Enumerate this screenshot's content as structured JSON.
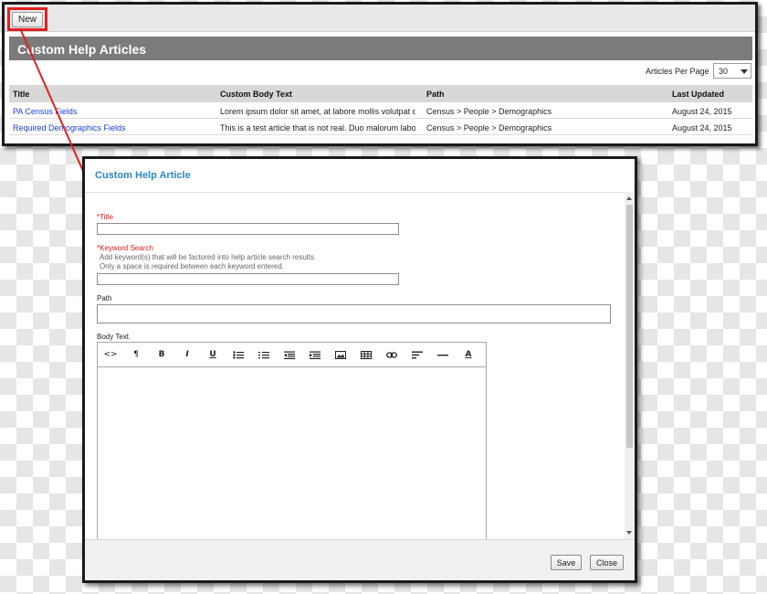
{
  "list": {
    "new_button": "New",
    "header_title": "Custom Help Articles",
    "per_page_label": "Articles Per Page",
    "per_page_value": "30",
    "columns": {
      "title": "Title",
      "body": "Custom Body Text",
      "path": "Path",
      "updated": "Last Updated"
    },
    "rows": [
      {
        "title": "PA Census Fields",
        "body": "Lorem ipsum dolor sit amet, at labore mollis volutpat d",
        "path": "Census > People > Demographics",
        "updated": "August 24, 2015"
      },
      {
        "title": "Required Demographics Fields",
        "body": "This is a test article that is not real.  Duo malorum labo",
        "path": "Census > People > Demographics",
        "updated": "August 24, 2015"
      }
    ]
  },
  "dialog": {
    "title": "Custom Help Article",
    "title_label": "*Title",
    "title_value": "",
    "keyword_label": "*Keyword Search",
    "keyword_hint_1": "Add keyword(s) that will be factored into help article search results.",
    "keyword_hint_2": "Only a space is required between each keyword entered.",
    "keyword_value": "",
    "path_label": "Path",
    "path_value": "",
    "body_label": "Body Text",
    "save_label": "Save",
    "close_label": "Close"
  },
  "toolbar_icons": [
    "code-view-icon",
    "paragraph-icon",
    "bold-icon",
    "italic-icon",
    "underline-icon",
    "bullet-list-icon",
    "numbered-list-icon",
    "outdent-icon",
    "indent-icon",
    "image-icon",
    "table-icon",
    "link-icon",
    "align-left-icon",
    "horizontal-rule-icon",
    "font-color-icon"
  ],
  "toolbar_glyphs": {
    "code": "<>",
    "paragraph": "¶",
    "bold": "B",
    "italic": "I",
    "underline": "U",
    "font_color": "A"
  },
  "colors": {
    "required": "#e01b1b",
    "link": "#1a3fd6",
    "dialog_title": "#2a88c6",
    "header_bar": "#7b7b7b",
    "annotation": "#e02020"
  }
}
